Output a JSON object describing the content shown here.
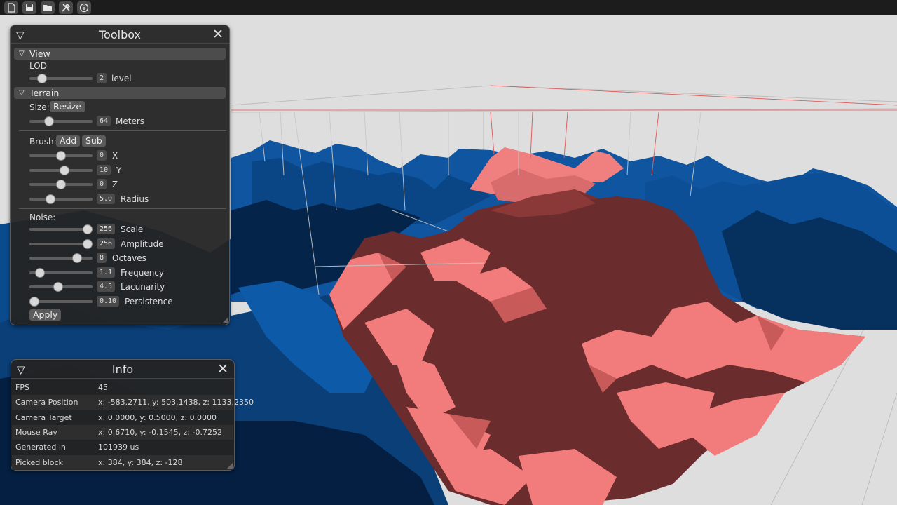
{
  "toolbar": {
    "icons": [
      "new-file-icon",
      "save-icon",
      "open-folder-icon",
      "tools-icon",
      "info-icon"
    ]
  },
  "toolbox": {
    "title": "Toolbox",
    "view": {
      "header": "View",
      "lod_label": "LOD",
      "lod": {
        "value": "2",
        "label": "level",
        "fraction": 0.14
      }
    },
    "terrain": {
      "header": "Terrain",
      "size_label": "Size:",
      "resize": "Resize",
      "size": {
        "value": "64",
        "label": "Meters",
        "fraction": 0.28
      },
      "brush_label": "Brush:",
      "add": "Add",
      "sub": "Sub",
      "brush": [
        {
          "value": "0",
          "label": "X",
          "fraction": 0.5
        },
        {
          "value": "10",
          "label": "Y",
          "fraction": 0.57
        },
        {
          "value": "0",
          "label": "Z",
          "fraction": 0.5
        },
        {
          "value": "5.0",
          "label": "Radius",
          "fraction": 0.3
        }
      ],
      "noise_label": "Noise:",
      "noise": [
        {
          "value": "256",
          "label": "Scale",
          "fraction": 1.0
        },
        {
          "value": "256",
          "label": "Amplitude",
          "fraction": 1.0
        },
        {
          "value": "8",
          "label": "Octaves",
          "fraction": 0.8
        },
        {
          "value": "1.1",
          "label": "Frequency",
          "fraction": 0.1
        },
        {
          "value": "4.5",
          "label": "Lacunarity",
          "fraction": 0.45
        },
        {
          "value": "0.10",
          "label": "Persistence",
          "fraction": 0.0
        }
      ],
      "apply": "Apply"
    }
  },
  "info": {
    "title": "Info",
    "rows": [
      {
        "key": "FPS",
        "value": "45"
      },
      {
        "key": "Camera Position",
        "value": "x: -583.2711, y: 503.1438, z: 1133.2350"
      },
      {
        "key": "Camera Target",
        "value": "x: 0.0000, y: 0.5000, z: 0.0000"
      },
      {
        "key": "Mouse Ray",
        "value": "x: 0.6710, y: -0.1545, z: -0.7252"
      },
      {
        "key": "Generated in",
        "value": "101939 us"
      },
      {
        "key": "Picked block",
        "value": "x: 384, y: 384, z: -128"
      }
    ]
  },
  "colors": {
    "terrain_blue": "#0d4f8f",
    "terrain_dark_blue": "#062a52",
    "brush_red": "#f07777",
    "brush_dark_red": "#6a2b2b",
    "background": "#dcdcdc"
  }
}
